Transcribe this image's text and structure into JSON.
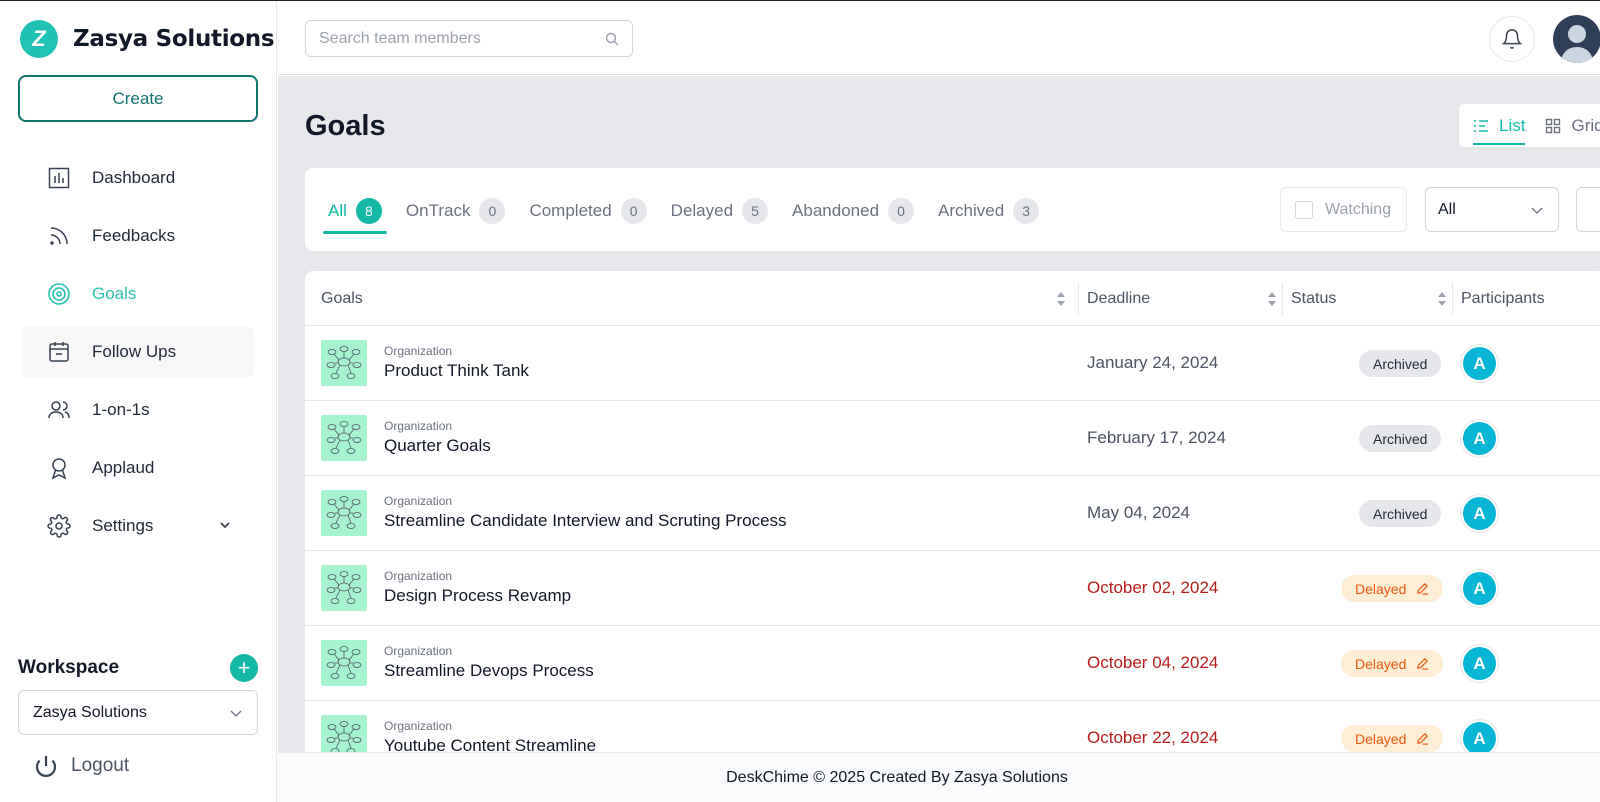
{
  "brand": {
    "name": "Zasya Solutions",
    "logo_letter": "Z",
    "accent": "#14b8a6"
  },
  "sidebar": {
    "create_label": "Create",
    "items": [
      {
        "label": "Dashboard",
        "icon": "bar-chart-icon"
      },
      {
        "label": "Feedbacks",
        "icon": "rss-icon"
      },
      {
        "label": "Goals",
        "icon": "target-icon",
        "active": true
      },
      {
        "label": "Follow Ups",
        "icon": "calendar-icon"
      },
      {
        "label": "1-on-1s",
        "icon": "users-icon"
      },
      {
        "label": "Applaud",
        "icon": "award-icon"
      },
      {
        "label": "Settings",
        "icon": "gear-icon"
      }
    ],
    "workspace_title": "Workspace",
    "workspace_value": "Zasya Solutions",
    "logout_label": "Logout"
  },
  "topbar": {
    "search_placeholder": "Search team members"
  },
  "main": {
    "title": "Goals",
    "view": {
      "list_label": "List",
      "grid_label": "Grid"
    },
    "tabs": [
      {
        "label": "All",
        "count": "8"
      },
      {
        "label": "OnTrack",
        "count": "0"
      },
      {
        "label": "Completed",
        "count": "0"
      },
      {
        "label": "Delayed",
        "count": "5"
      },
      {
        "label": "Abandoned",
        "count": "0"
      },
      {
        "label": "Archived",
        "count": "3"
      }
    ],
    "watching_label": "Watching",
    "filter_value": "All",
    "columns": {
      "goals": "Goals",
      "deadline": "Deadline",
      "status": "Status",
      "participants": "Participants"
    },
    "rows": [
      {
        "kind": "Organization",
        "name": "Product Think Tank",
        "deadline": "January 24, 2024",
        "status": "Archived",
        "participant": "A"
      },
      {
        "kind": "Organization",
        "name": "Quarter Goals",
        "deadline": "February 17, 2024",
        "status": "Archived",
        "participant": "A"
      },
      {
        "kind": "Organization",
        "name": "Streamline Candidate Interview and Scruting Process",
        "deadline": "May 04, 2024",
        "status": "Archived",
        "participant": "A"
      },
      {
        "kind": "Organization",
        "name": "Design Process Revamp",
        "deadline": "October 02, 2024",
        "status": "Delayed",
        "participant": "A"
      },
      {
        "kind": "Organization",
        "name": "Streamline Devops Process",
        "deadline": "October 04, 2024",
        "status": "Delayed",
        "participant": "A"
      },
      {
        "kind": "Organization",
        "name": "Youtube Content Streamline",
        "deadline": "October 22, 2024",
        "status": "Delayed",
        "participant": "A"
      }
    ]
  },
  "footer": {
    "text": "DeskChime © 2025 Created By Zasya Solutions"
  }
}
